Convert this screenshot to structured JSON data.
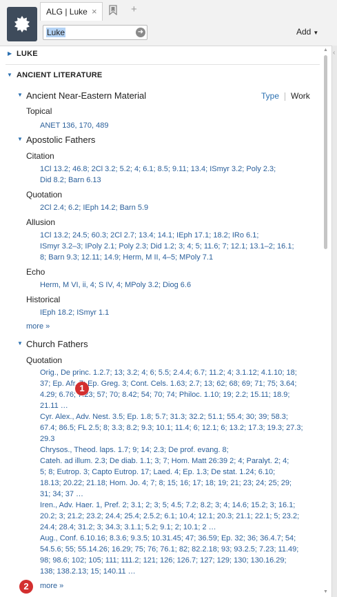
{
  "tab": {
    "title": "ALG | Luke",
    "close": "×",
    "new_tab": "+"
  },
  "search": {
    "value": "Luke"
  },
  "toolbar": {
    "add_label": "Add"
  },
  "sections": {
    "luke": "LUKE",
    "ancient": "ANCIENT LITERATURE"
  },
  "view_toggle": {
    "type": "Type",
    "work": "Work"
  },
  "ane": {
    "title": "Ancient Near-Eastern Material",
    "topical": "Topical",
    "topical_refs": "ANET 136, 170, 489"
  },
  "apostolic": {
    "title": "Apostolic Fathers",
    "citation": "Citation",
    "citation_refs": [
      "1Cl 13.2; 46.8; 2Cl 3.2; 5.2; 4; 6.1; 8.5; 9.11; 13.4; ISmyr 3.2; Poly 2.3;",
      "Did 8.2; Barn 6.13"
    ],
    "quotation": "Quotation",
    "quotation_refs": "2Cl 2.4; 6.2; IEph 14.2; Barn 5.9",
    "allusion": "Allusion",
    "allusion_refs": [
      "1Cl 13.2; 24.5; 60.3; 2Cl 2.7; 13.4; 14.1; IEph 17.1; 18.2; IRo 6.1;",
      "ISmyr 3.2–3; IPoly 2.1; Poly 2.3; Did 1.2; 3; 4; 5; 11.6; 7; 12.1; 13.1–2; 16.1;",
      "8; Barn 9.3; 12.11; 14.9; Herm, M II, 4–5; MPoly 7.1"
    ],
    "echo": "Echo",
    "echo_refs": "Herm, M VI, ii, 4; S IV, 4; MPoly 3.2; Diog 6.6",
    "historical": "Historical",
    "historical_refs": "IEph 18.2; ISmyr 1.1",
    "more": "more »"
  },
  "church": {
    "title": "Church Fathers",
    "quotation": "Quotation",
    "groups": [
      [
        "Orig., De princ. 1.2.7; 13; 3.2; 4; 6; 5.5; 2.4.4; 6.7; 11.2; 4; 3.1.12; 4.1.10; 18;",
        "37; Ep. Afr. 7; Ep. Greg. 3; Cont. Cels. 1.63; 2.7; 13; 62; 68; 69; 71; 75; 3.64;",
        "4.29; 6.76; 7.23; 57; 70; 8.42; 54; 70; 74; Philoc. 1.10; 19; 2.2; 15.11; 18.9;",
        "21.11 …"
      ],
      [
        "Cyr. Alex., Adv. Nest. 3.5; Ep. 1.8; 5.7; 31.3; 32.2; 51.1; 55.4; 30; 39; 58.3;",
        "67.4; 86.5; FL 2.5; 8; 3.3; 8.2; 9.3; 10.1; 11.4; 6; 12.1; 6; 13.2; 17.3; 19.3; 27.3;",
        "29.3"
      ],
      [
        "Chrysos., Theod. laps. 1.7; 9; 14; 2.3; De prof. evang. 8;",
        "Cateh. ad illum. 2.3; De diab. 1.1; 3; 7; Hom. Matt 26:39 2; 4; Paralyt. 2; 4;",
        "5; 8; Eutrop. 3; Capto Eutrop. 17; Laed. 4; Ep. 1.3; De stat. 1.24; 6.10;",
        "18.13; 20.22; 21.18; Hom. Jo. 4; 7; 8; 15; 16; 17; 18; 19; 21; 23; 24; 25; 29;",
        "31; 34; 37 …"
      ],
      [
        "Iren., Adv. Haer. 1, Pref. 2; 3.1; 2; 3; 5; 4.5; 7.2; 8.2; 3; 4; 14.6; 15.2; 3; 16.1;",
        "20.2; 3; 21.2; 23.2; 24.4; 25.4; 2.5.2; 6.1; 10.4; 12.1; 20.3; 21.1; 22.1; 5; 23.2;",
        "24.4; 28.4; 31.2; 3; 34.3; 3.1.1; 5.2; 9.1; 2; 10.1; 2 …"
      ],
      [
        "Aug., Conf. 6.10.16; 8.3.6; 9.3.5; 10.31.45; 47; 36.59; Ep. 32; 36; 36.4.7; 54;",
        "54.5.6; 55; 55.14.26; 16.29; 75; 76; 76.1; 82; 82.2.18; 93; 93.2.5; 7.23; 11.49;",
        "98; 98.6; 102; 105; 111; 111.2; 121; 126; 126.7; 127; 129; 130; 130.16.29;",
        "138; 138.2.13; 15; 140.11 …"
      ]
    ],
    "more": "more »"
  },
  "badges": {
    "first": "1",
    "second": "2"
  },
  "colors": {
    "link": "#2a5f9a",
    "accent": "#2a6fb0",
    "badge": "#d32f2f",
    "logo_bg": "#3e4b5b"
  }
}
